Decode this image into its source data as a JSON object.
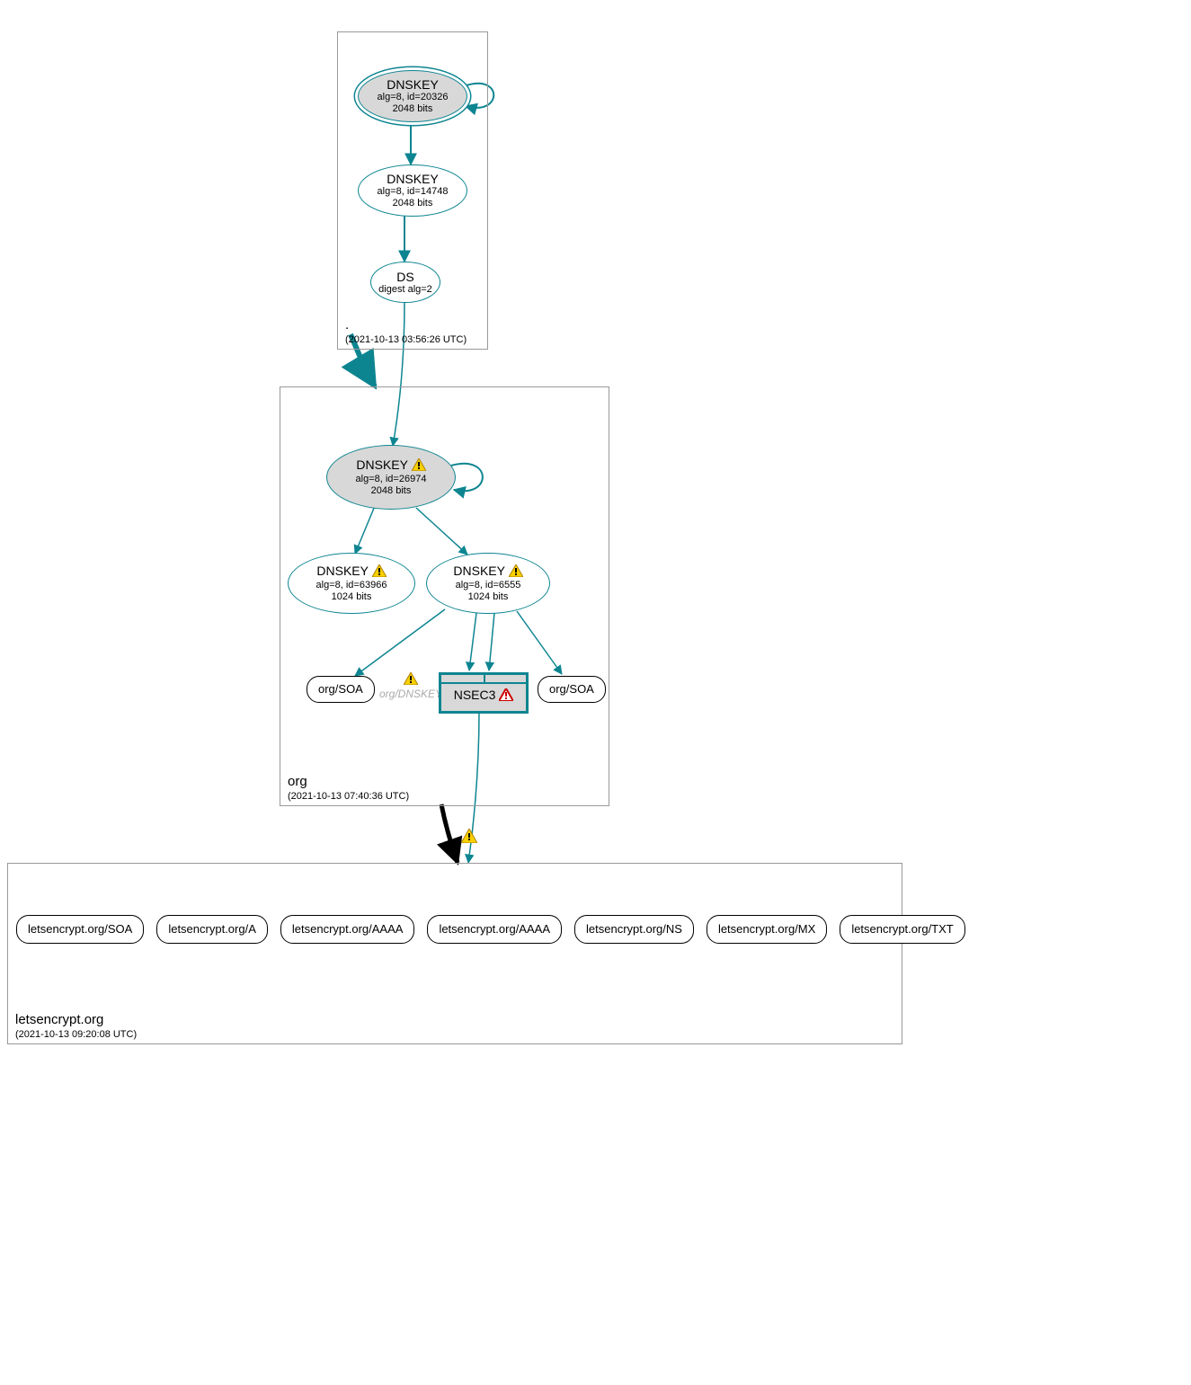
{
  "zones": {
    "root": {
      "name": ".",
      "timestamp": "(2021-10-13 03:56:26 UTC)"
    },
    "org": {
      "name": "org",
      "timestamp": "(2021-10-13 07:40:36 UTC)"
    },
    "le": {
      "name": "letsencrypt.org",
      "timestamp": "(2021-10-13 09:20:08 UTC)"
    }
  },
  "nodes": {
    "root_ksk": {
      "title": "DNSKEY",
      "line1": "alg=8, id=20326",
      "line2": "2048 bits"
    },
    "root_zsk": {
      "title": "DNSKEY",
      "line1": "alg=8, id=14748",
      "line2": "2048 bits"
    },
    "root_ds": {
      "title": "DS",
      "line1": "digest alg=2"
    },
    "org_ksk": {
      "title": "DNSKEY",
      "line1": "alg=8, id=26974",
      "line2": "2048 bits",
      "warn": true
    },
    "org_zsk1": {
      "title": "DNSKEY",
      "line1": "alg=8, id=63966",
      "line2": "1024 bits",
      "warn": true
    },
    "org_zsk2": {
      "title": "DNSKEY",
      "line1": "alg=8, id=6555",
      "line2": "1024 bits",
      "warn": true
    },
    "org_soa1": {
      "label": "org/SOA"
    },
    "org_soa2": {
      "label": "org/SOA"
    },
    "org_dnskey": {
      "label": "org/DNSKEY",
      "warn": true
    },
    "nsec3": {
      "label": "NSEC3",
      "error": true
    }
  },
  "leaf_records": [
    "letsencrypt.org/SOA",
    "letsencrypt.org/A",
    "letsencrypt.org/AAAA",
    "letsencrypt.org/AAAA",
    "letsencrypt.org/NS",
    "letsencrypt.org/MX",
    "letsencrypt.org/TXT"
  ],
  "edge_warn": true,
  "colors": {
    "teal": "#0d8591",
    "fill": "#d8d8d8"
  }
}
